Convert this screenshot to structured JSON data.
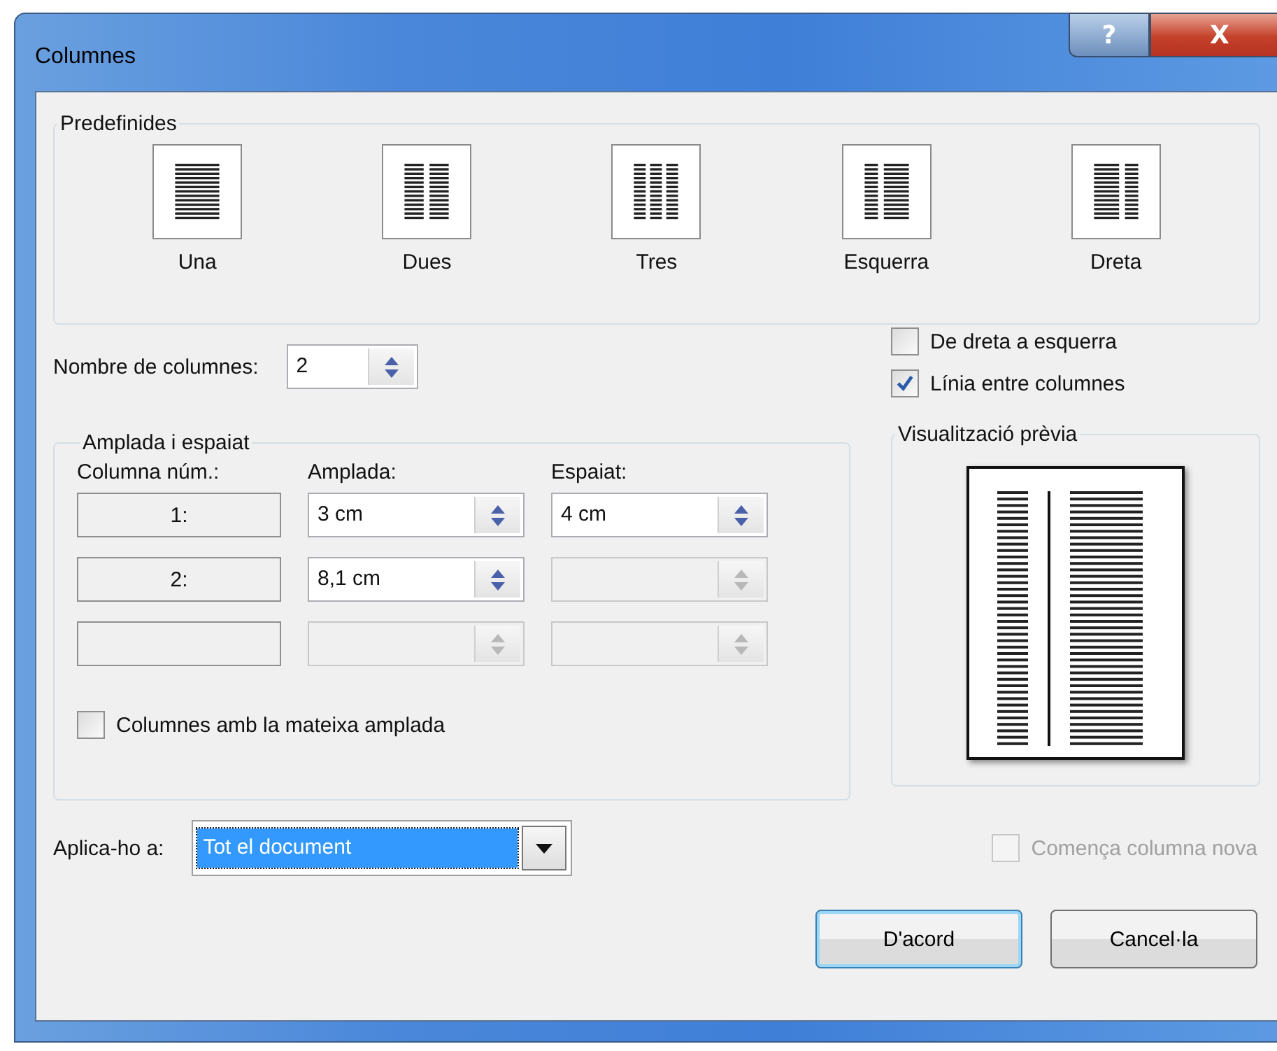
{
  "window": {
    "title": "Columnes",
    "help": "?",
    "close": "X"
  },
  "presets": {
    "label": "Predefinides",
    "items": [
      {
        "kind": "one",
        "label": "Una"
      },
      {
        "kind": "two",
        "label": "Dues"
      },
      {
        "kind": "three",
        "label": "Tres"
      },
      {
        "kind": "left",
        "label": "Esquerra"
      },
      {
        "kind": "right",
        "label": "Dreta"
      }
    ]
  },
  "number": {
    "label": "Nombre de columnes:",
    "value": "2"
  },
  "options": [
    {
      "label": "De dreta a esquerra",
      "checked": false,
      "disabled": false
    },
    {
      "label": "Línia entre columnes",
      "checked": true,
      "disabled": false
    }
  ],
  "width_spacing": {
    "label": "Amplada i espaiat",
    "headers": [
      "Columna núm.:",
      "Amplada:",
      "Espaiat:"
    ],
    "rows": [
      {
        "number": "1:",
        "width": {
          "value": "3 cm",
          "disabled": false
        },
        "spacing": {
          "value": "4 cm",
          "disabled": false
        }
      },
      {
        "number": "2:",
        "width": {
          "value": "8,1 cm",
          "disabled": false
        },
        "spacing": {
          "disabled": true
        }
      },
      {
        "width": {
          "disabled": true
        },
        "spacing": {
          "disabled": true
        }
      }
    ],
    "equal": {
      "label": "Columnes amb la mateixa amplada",
      "checked": false
    }
  },
  "preview": {
    "label": "Visualització prèvia"
  },
  "apply": {
    "label": "Aplica-ho a:",
    "value": "Tot el document"
  },
  "start_new": {
    "label": "Comença columna nova",
    "checked": false,
    "disabled": true
  },
  "buttons": [
    {
      "label": "D'acord",
      "default": true
    },
    {
      "label": "Cancel·la",
      "default": false
    }
  ]
}
